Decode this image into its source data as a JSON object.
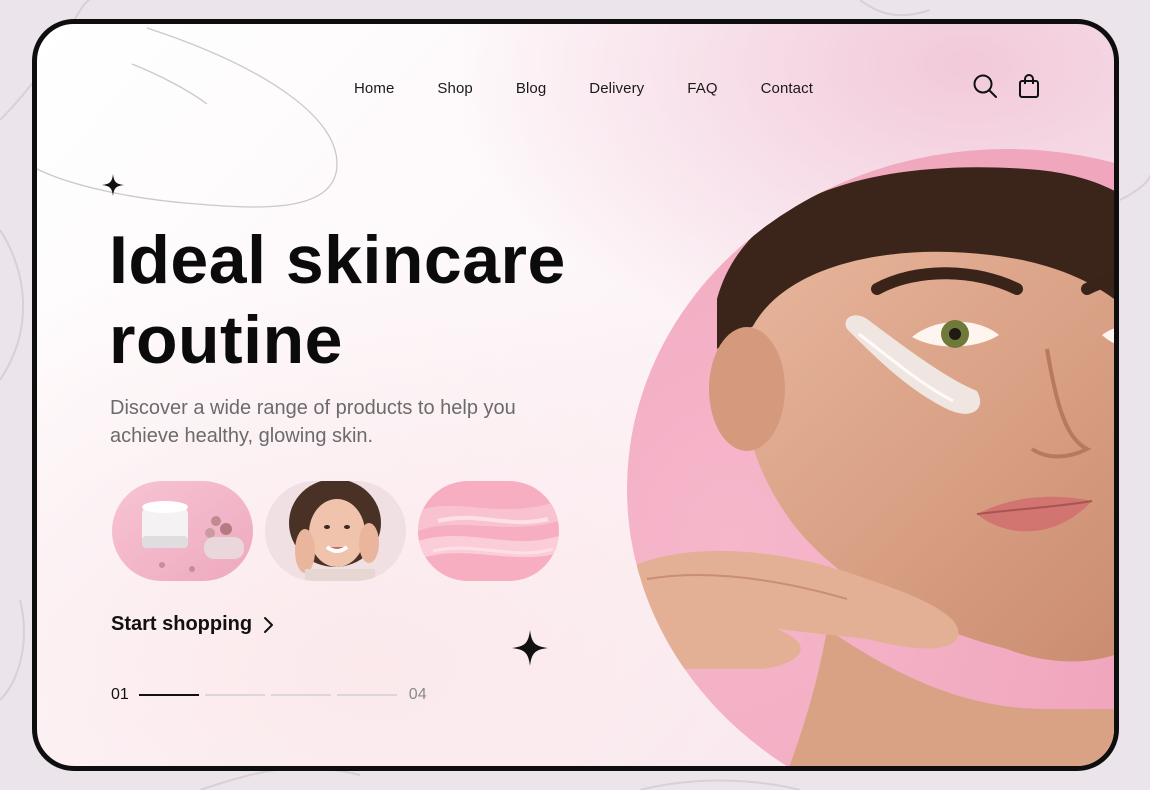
{
  "nav": {
    "items": [
      {
        "label": "Home"
      },
      {
        "label": "Shop"
      },
      {
        "label": "Blog"
      },
      {
        "label": "Delivery"
      },
      {
        "label": "FAQ"
      },
      {
        "label": "Contact"
      }
    ],
    "icons": [
      "search-icon",
      "shopping-bag-icon"
    ]
  },
  "hero": {
    "title_line1": "Ideal skincare",
    "title_line2": "routine",
    "subtitle": "Discover a wide range of products to help you achieve healthy, glowing skin.",
    "cta_label": "Start shopping",
    "cta_icon": "chevron-right-icon"
  },
  "thumbnails": [
    {
      "name": "cream-jar-thumbnail"
    },
    {
      "name": "smiling-woman-thumbnail"
    },
    {
      "name": "pink-cream-texture-thumbnail"
    }
  ],
  "pager": {
    "current": "01",
    "total": "04",
    "active_index": 0,
    "count": 4
  },
  "colors": {
    "accent_pink": "#f3c3d6",
    "text_dark": "#0b0b0b",
    "text_muted": "#6b6b6b",
    "frame": "#0e0e0e"
  }
}
